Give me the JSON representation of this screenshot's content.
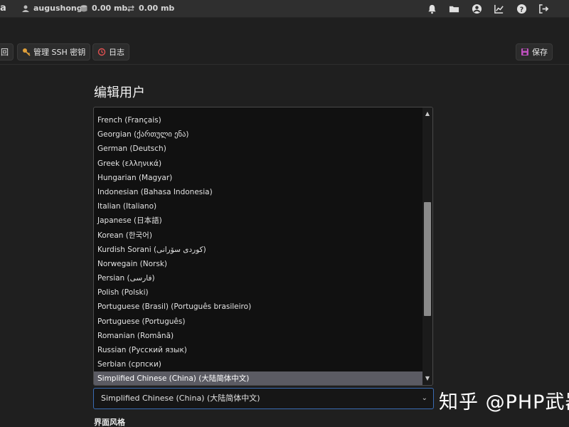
{
  "topbar": {
    "brand": "a",
    "username": "augushong",
    "upload": "0.00 mb",
    "download": "0.00 mb",
    "icons": [
      "user-icon",
      "transfer-icon",
      "bell-icon",
      "folder-icon",
      "account-circle-icon",
      "chart-icon",
      "help-icon",
      "logout-icon"
    ]
  },
  "toolbar": {
    "back_label": "回",
    "ssh_label": "管理 SSH 密钥",
    "log_label": "日志",
    "save_label": "保存",
    "colors": {
      "key_icon": "#e0a03a",
      "log_icon": "#e05050",
      "save_icon": "#c050c0"
    }
  },
  "page": {
    "title": "编辑用户",
    "section_label": "界面风格"
  },
  "language_list": {
    "items": [
      "French (Français)",
      "Georgian (ქართული ენა)",
      "German (Deutsch)",
      "Greek (ελληνικά)",
      "Hungarian (Magyar)",
      "Indonesian (Bahasa Indonesia)",
      "Italian (Italiano)",
      "Japanese (日本語)",
      "Korean (한국어)",
      "Kurdish Sorani (کوردی سۆرانی)",
      "Norwegain (Norsk)",
      "Persian (فارسی)",
      "Polish (Polski)",
      "Portuguese (Brasil) (Português brasileiro)",
      "Portuguese (Português)",
      "Romanian (Română)",
      "Russian (Русский язык)",
      "Serbian (српски)",
      "Simplified Chinese (China) (大陆简体中文)"
    ],
    "selected": "Simplified Chinese (China) (大陆简体中文)",
    "selected_color": "#5b5b63"
  },
  "language_select": {
    "value": "Simplified Chinese (China) (大陆简体中文)",
    "border_color": "#3a6cb3"
  },
  "watermark": "知乎 @PHP武器"
}
